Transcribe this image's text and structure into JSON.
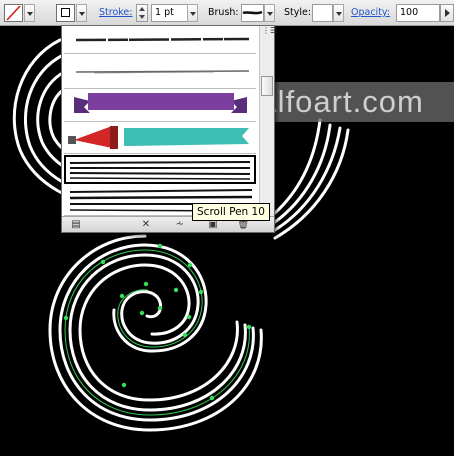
{
  "control_bar": {
    "stroke_label": "Stroke:",
    "stroke_weight": "1 pt",
    "brush_label": "Brush:",
    "style_label": "Style:",
    "opacity_label": "Opacity:",
    "opacity_value": "100"
  },
  "brush_panel": {
    "menu_icon": "panel-menu-icon",
    "footer_icons": [
      "brush-libraries-icon",
      "remove-brush-stroke-icon",
      "brush-options-icon",
      "new-brush-icon",
      "delete-brush-icon"
    ],
    "tooltip": "Scroll Pen 10",
    "selected_row": 5
  },
  "artwork": {
    "watermark": "Alfoart.com",
    "spiral_color": "#ffffff",
    "anchor_color": "#35e05a"
  },
  "colors": {
    "banner_purple": "#7b3fa0",
    "ribbon_teal": "#3dbdb4",
    "megaphone_red": "#d32626"
  }
}
